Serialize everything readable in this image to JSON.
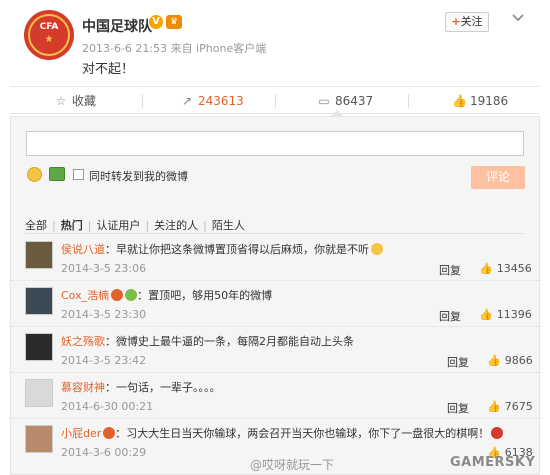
{
  "post": {
    "username": "中国足球队",
    "v_badge": "V",
    "meta": "2013-6-6 21:53 来自 iPhone客户端",
    "text": "对不起！",
    "follow_label": "关注",
    "follow_plus": "+"
  },
  "actions": {
    "favorite_label": "收藏",
    "reposts": "243613",
    "comments": "86437",
    "likes": "19186"
  },
  "composer": {
    "input_value": "",
    "checkbox_label": "同时转发到我的微博",
    "submit_label": "评论"
  },
  "filters": [
    "全部",
    "热门",
    "认证用户",
    "关注的人",
    "陌生人"
  ],
  "comments": [
    {
      "name": "侯说八道",
      "text": "：早就让你把这条微博置顶省得以后麻烦，你就是不听",
      "time": "2014-3-5 23:06",
      "reply": "回复",
      "likes": "13456"
    },
    {
      "name": "Cox_浩楠",
      "text": "：置顶吧，够用50年的微博",
      "time": "2014-3-5 23:30",
      "reply": "回复",
      "likes": "11396"
    },
    {
      "name": "妖之殇歌",
      "text": "：微博史上最牛逼的一条，每隔2月都能自动上头条",
      "time": "2014-3-5 23:42",
      "reply": "回复",
      "likes": "9866"
    },
    {
      "name": "慕容财神",
      "text": "：一句话，一辈子。。。。",
      "time": "2014-6-30 00:21",
      "reply": "回复",
      "likes": "7675"
    },
    {
      "name": "小屁der",
      "text": "：习大大生日当天你输球，两会召开当天你也输球，你下了一盘很大的棋啊！",
      "time": "2014-3-6 00:29",
      "reply": "回复",
      "likes": "6138"
    }
  ],
  "watermark": "@哎呀就玩一下",
  "brand": "GAMERSKY",
  "colors": {
    "accent": "#e2632a",
    "submit_bg": "#ffc09f",
    "panel_bg": "#f5f5f5"
  }
}
